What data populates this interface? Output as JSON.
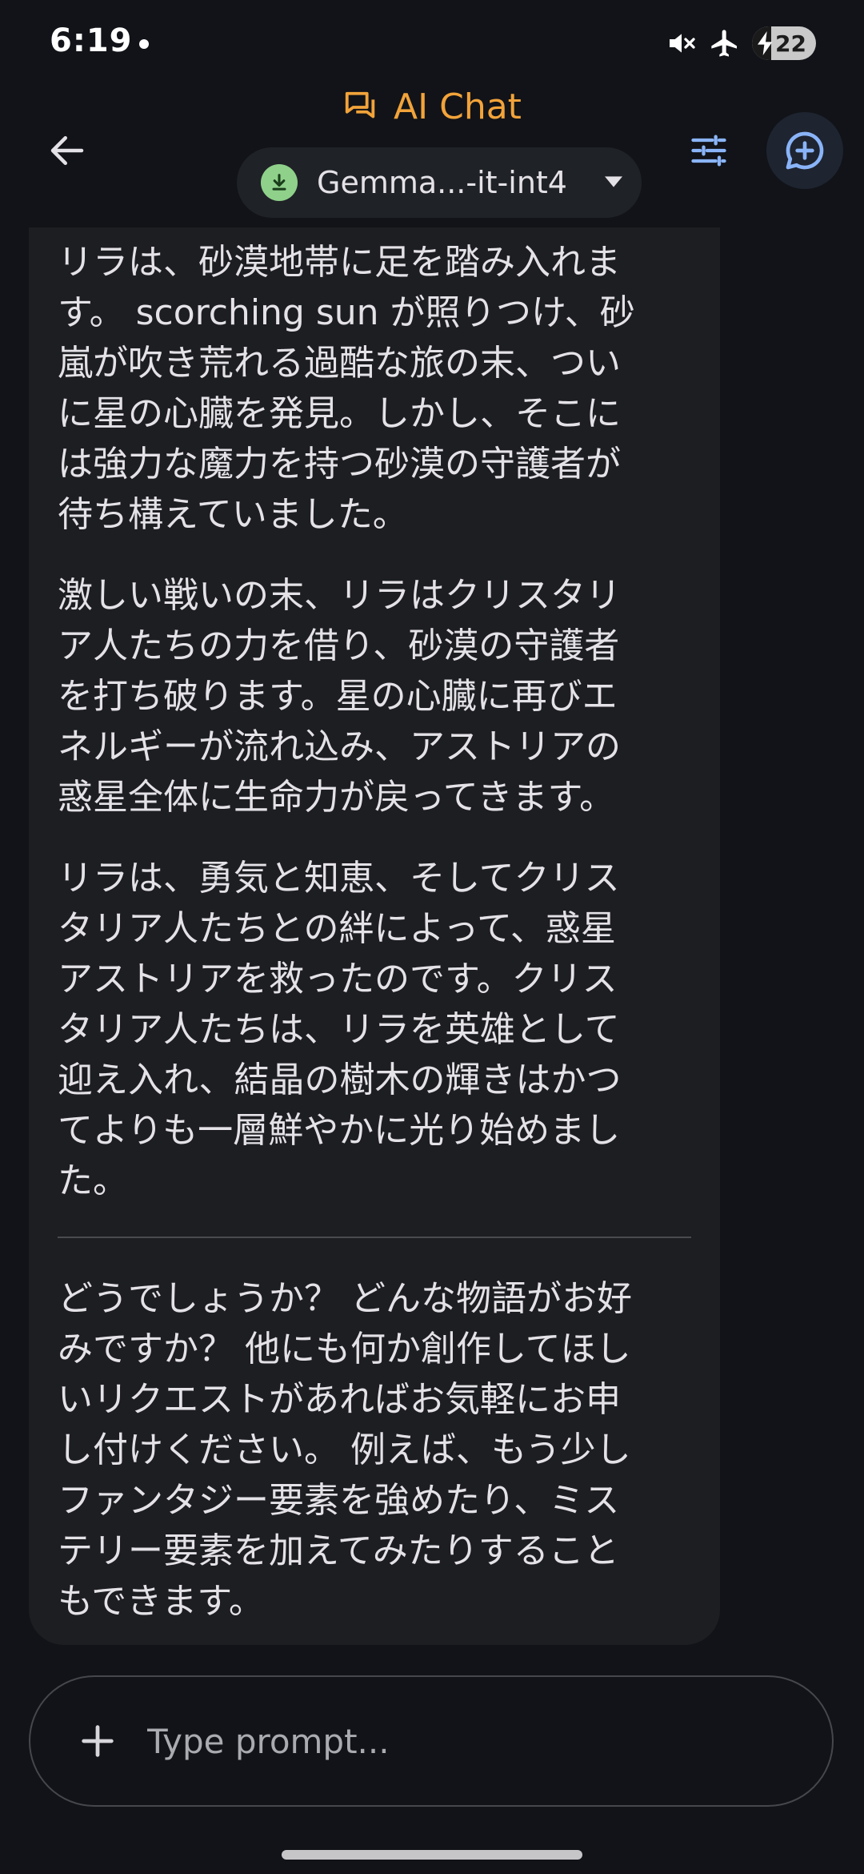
{
  "status_bar": {
    "time": "6:19",
    "battery_level": "22",
    "icons": [
      "notification-dot-icon",
      "mute-icon",
      "airplane-icon",
      "battery-charging-icon"
    ]
  },
  "app_bar": {
    "title": "AI Chat",
    "title_icon": "chat-icon",
    "back_icon": "back-arrow-icon",
    "tune_icon": "tune-icon",
    "new_chat_icon": "add-chat-icon"
  },
  "model_selector": {
    "name": "Gemma...-it-int4",
    "icon": "download-done-icon",
    "caret_icon": "dropdown-caret-icon"
  },
  "message": {
    "paragraphs": [
      "リラは、砂漠地帯に足を踏み入れま\nす。 scorching sun が照りつけ、砂\n嵐が吹き荒れる過酷な旅の末、つい\nに星の心臓を発見。しかし、そこに\nは強力な魔力を持つ砂漠の守護者が\n待ち構えていました。",
      "激しい戦いの末、リラはクリスタリ\nア人たちの力を借り、砂漠の守護者\nを打ち破ります。星の心臓に再びエ\nネルギーが流れ込み、アストリアの\n惑星全体に生命力が戻ってきます。",
      "リラは、勇気と知恵、そしてクリス\nタリア人たちとの絆によって、惑星\nアストリアを救ったのです。クリス\nタリア人たちは、リラを英雄として\n迎え入れ、結晶の樹木の輝きはかつ\nてよりも一層鮮やかに光り始めまし\nた。"
    ],
    "followup": "どうでしょうか？ どんな物語がお好\nみですか？ 他にも何か創作してほし\nいリクエストがあればお気軽にお申\nし付けください。 例えば、もう少し\nファンタジー要素を強めたり、ミス\nテリー要素を加えてみたりすること\nもできます。"
  },
  "input": {
    "placeholder": "Type prompt...",
    "value": "",
    "add_icon": "plus-icon"
  },
  "colors": {
    "background": "#111318",
    "accent": "#f2a33a",
    "icon_blue": "#8ab4f8",
    "model_badge": "#8fd18a",
    "bubble": "#1d1e21"
  }
}
